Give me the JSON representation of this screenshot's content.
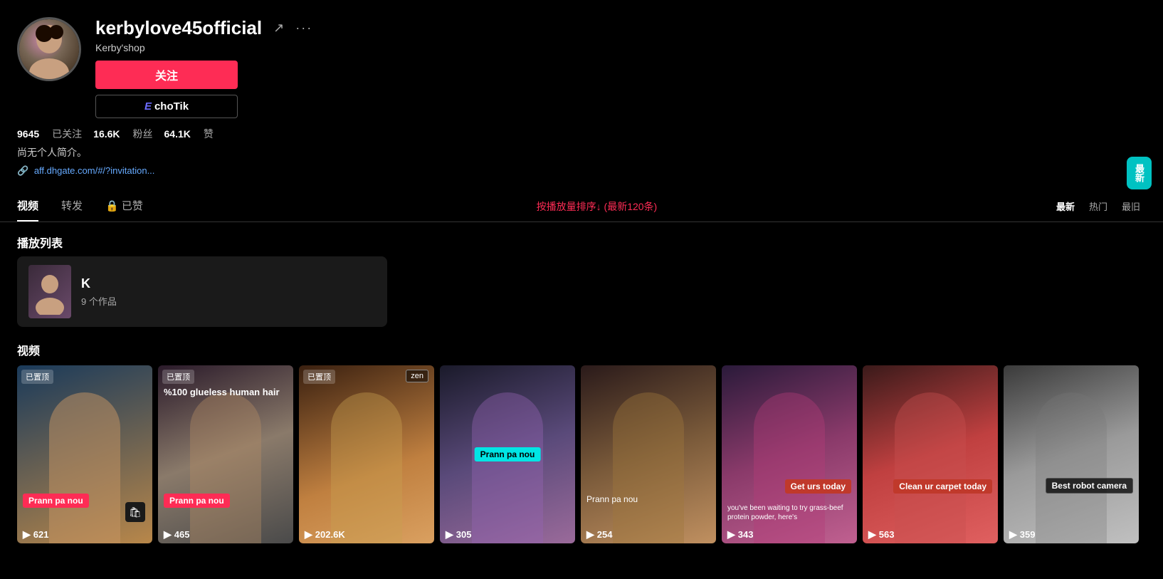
{
  "profile": {
    "username": "kerbylove45official",
    "shop": "Kerby'shop",
    "follow_btn": "关注",
    "echotik_btn_prefix": "E",
    "echotik_btn_text": "choTik",
    "link": "aff.dhgate.com/#/?invitation...",
    "bio": "尚无个人简介。",
    "stats": {
      "following": "9645",
      "following_label": "已关注",
      "followers": "16.6K",
      "followers_label": "粉丝",
      "likes": "64.1K",
      "likes_label": "赞"
    }
  },
  "tabs": {
    "items": [
      {
        "label": "视频",
        "active": true
      },
      {
        "label": "转发",
        "active": false
      },
      {
        "label": "已赞",
        "active": false,
        "lock": true
      }
    ],
    "filter_label": "按播放量排序↓ (最新120条)"
  },
  "sort_buttons": [
    {
      "label": "最新",
      "active": true
    },
    {
      "label": "热门",
      "active": false
    },
    {
      "label": "最旧",
      "active": false
    }
  ],
  "latest_badge": "最新",
  "playlist_section_title": "播放列表",
  "playlist": {
    "name": "K",
    "count": "9 个作品"
  },
  "videos_section_title": "视频",
  "videos": [
    {
      "bg_class": "video-bg-1",
      "pinned": true,
      "pinned_label": "已置顶",
      "overlay_label": "Prann pa nou",
      "overlay_type": "red",
      "overlay_pos": "mid-left",
      "count": "621",
      "has_bag_icon": true
    },
    {
      "bg_class": "video-bg-2",
      "pinned": true,
      "pinned_label": "已置顶",
      "overlay_label": "%100 glueless human hair",
      "overlay_type": "none",
      "overlay_pos": "top-right",
      "overlay2_label": "Prann pa nou",
      "overlay2_type": "red",
      "count": "465"
    },
    {
      "bg_class": "video-bg-3",
      "pinned": true,
      "pinned_label": "已置顶",
      "overlay_small_label": "zen",
      "overlay_label": "",
      "overlay_type": "none",
      "count": "202.6K"
    },
    {
      "bg_class": "video-bg-4",
      "pinned": false,
      "overlay_label": "Prann pa nou",
      "overlay_type": "cyan",
      "overlay_pos": "center",
      "count": "305"
    },
    {
      "bg_class": "video-bg-5",
      "pinned": false,
      "overlay_label": "Prann pa nou",
      "overlay_type": "none",
      "overlay_pos": "bottom",
      "count": "254"
    },
    {
      "bg_class": "video-bg-6",
      "pinned": false,
      "overlay_label": "Get urs today",
      "overlay_type": "dark-red",
      "overlay_pos": "mid-right",
      "overlay_sub": "you've been waiting to try grass-beef protein powder, here's",
      "count": "343"
    },
    {
      "bg_class": "video-bg-7",
      "pinned": false,
      "overlay_label": "Clean ur carpet today",
      "overlay_type": "dark-red",
      "overlay_pos": "mid-right",
      "count": "563"
    },
    {
      "bg_class": "video-bg-8",
      "pinned": false,
      "overlay_label": "Best robot camera",
      "overlay_type": "black",
      "overlay_pos": "bottom-right",
      "count": "359"
    }
  ]
}
